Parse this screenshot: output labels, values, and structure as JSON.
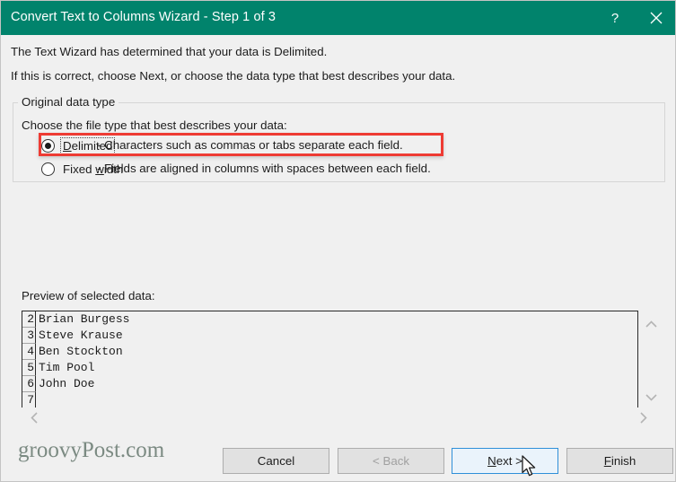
{
  "window": {
    "title": "Convert Text to Columns Wizard - Step 1 of 3",
    "accent_color": "#01836c",
    "help_icon": "?",
    "close_icon": "close-icon"
  },
  "intro": {
    "line1": "The Text Wizard has determined that your data is Delimited.",
    "line2": "If this is correct, choose Next, or choose the data type that best describes your data."
  },
  "group": {
    "legend": "Original data type",
    "instruction": "Choose the file type that best describes your data:",
    "options": [
      {
        "label": "Delimited",
        "accel": "D",
        "description": "- Characters such as commas or tabs separate each field.",
        "selected": true,
        "focused": true
      },
      {
        "label": "Fixed width",
        "accel": "w",
        "description": "- Fields are aligned in columns with spaces between each field.",
        "selected": false,
        "focused": false
      }
    ],
    "highlight_color": "#ee3b33"
  },
  "preview": {
    "label": "Preview of selected data:",
    "rows": [
      {
        "number": "2",
        "text": "Brian Burgess"
      },
      {
        "number": "3",
        "text": "Steve Krause"
      },
      {
        "number": "4",
        "text": "Ben Stockton"
      },
      {
        "number": "5",
        "text": "Tim Pool"
      },
      {
        "number": "6",
        "text": "John Doe"
      },
      {
        "number": "7",
        "text": ""
      }
    ],
    "scroll_up_icon": "chevron-up-icon",
    "scroll_down_icon": "chevron-down-icon",
    "scroll_left_icon": "chevron-left-icon",
    "scroll_right_icon": "chevron-right-icon"
  },
  "watermark": {
    "text": "groovyPost.com"
  },
  "buttons": {
    "cancel": "Cancel",
    "back": "< Back",
    "next": "Next >",
    "finish": "Finish",
    "next_accel": "N",
    "finish_accel": "F"
  }
}
